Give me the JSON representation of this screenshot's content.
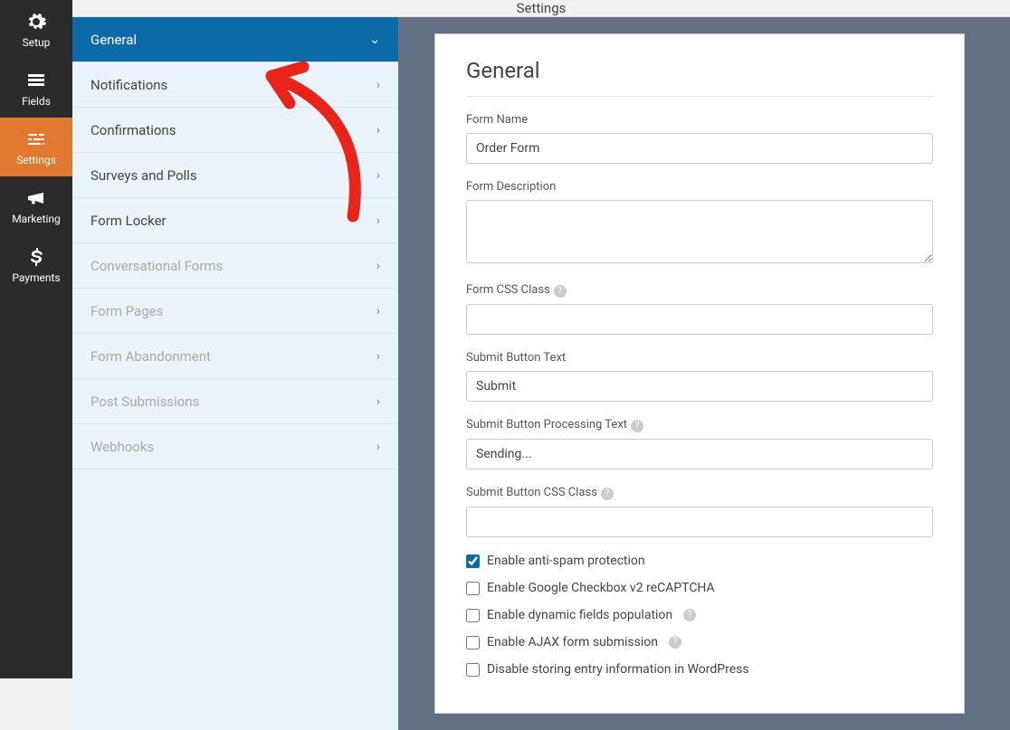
{
  "topbar": {
    "title": "Settings"
  },
  "rail": {
    "items": [
      {
        "label": "Setup",
        "icon": "gear",
        "active": false
      },
      {
        "label": "Fields",
        "icon": "list",
        "active": false
      },
      {
        "label": "Settings",
        "icon": "sliders",
        "active": true
      },
      {
        "label": "Marketing",
        "icon": "bullhorn",
        "active": false
      },
      {
        "label": "Payments",
        "icon": "dollar",
        "active": false
      }
    ]
  },
  "subnav": {
    "items": [
      {
        "label": "General",
        "active": true,
        "disabled": false,
        "expanded": true
      },
      {
        "label": "Notifications",
        "active": false,
        "disabled": false
      },
      {
        "label": "Confirmations",
        "active": false,
        "disabled": false
      },
      {
        "label": "Surveys and Polls",
        "active": false,
        "disabled": false
      },
      {
        "label": "Form Locker",
        "active": false,
        "disabled": false
      },
      {
        "label": "Conversational Forms",
        "active": false,
        "disabled": true
      },
      {
        "label": "Form Pages",
        "active": false,
        "disabled": true
      },
      {
        "label": "Form Abandonment",
        "active": false,
        "disabled": true
      },
      {
        "label": "Post Submissions",
        "active": false,
        "disabled": true
      },
      {
        "label": "Webhooks",
        "active": false,
        "disabled": true
      }
    ]
  },
  "panel": {
    "heading": "General",
    "fields": {
      "form_name": {
        "label": "Form Name",
        "value": "Order Form"
      },
      "form_description": {
        "label": "Form Description",
        "value": ""
      },
      "form_css_class": {
        "label": "Form CSS Class",
        "value": "",
        "help": true
      },
      "submit_text": {
        "label": "Submit Button Text",
        "value": "Submit"
      },
      "submit_processing": {
        "label": "Submit Button Processing Text",
        "value": "Sending...",
        "help": true
      },
      "submit_css_class": {
        "label": "Submit Button CSS Class",
        "value": "",
        "help": true
      }
    },
    "checkboxes": [
      {
        "label": "Enable anti-spam protection",
        "checked": true,
        "help": false
      },
      {
        "label": "Enable Google Checkbox v2 reCAPTCHA",
        "checked": false,
        "help": false
      },
      {
        "label": "Enable dynamic fields population",
        "checked": false,
        "help": true
      },
      {
        "label": "Enable AJAX form submission",
        "checked": false,
        "help": true
      },
      {
        "label": "Disable storing entry information in WordPress",
        "checked": false,
        "help": false
      }
    ]
  }
}
